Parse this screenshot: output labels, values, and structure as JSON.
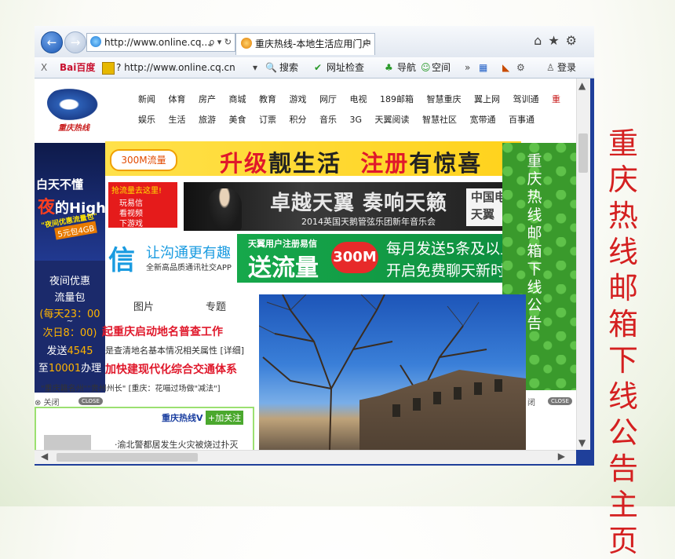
{
  "slide_title": "重庆热线邮箱下线公告主页",
  "browser": {
    "address": "http://www.online.cq...",
    "address_tools": "ϼ ▾ ↻",
    "tab_title": "重庆热线-本地生活应用门户",
    "toolbar": {
      "close_label": "X",
      "baidu": "Bai百度",
      "addr2": "? http://www.online.cq.cn",
      "search": "搜索",
      "site_check": "网址检查",
      "nav": "导航",
      "space": "空间",
      "login": "登录"
    }
  },
  "site": {
    "logo_text": "重庆热线",
    "nav_row1": [
      "新闻",
      "体育",
      "房产",
      "商城",
      "教育",
      "游戏",
      "网厅",
      "电视",
      "189邮箱",
      "智慧重庆",
      "翼上网",
      "驾训通",
      "重"
    ],
    "nav_row2": [
      "娱乐",
      "生活",
      "旅游",
      "美食",
      "订票",
      "积分",
      "音乐",
      "3G",
      "天翼阅读",
      "智慧社区",
      "宽带通",
      "百事通"
    ],
    "banner1_pill": "300M流量",
    "banner1_red1": "升级",
    "banner1_mid": "靓生活",
    "banner1_red2": "注册",
    "banner1_end": "有惊喜",
    "red_box": [
      "抢流量去这里!",
      "玩易信",
      "看视频",
      "下游戏"
    ],
    "concert_title": "卓越天翼 奏响天籁",
    "concert_sub": "2014英国天鹅管弦乐团新年音乐会",
    "concert_side": "中国电信 天翼",
    "yixin_big": "信",
    "yixin_title": "让沟通更有趣",
    "yixin_sub": "全新高品质通讯社交APP",
    "green_small": "天翼用户注册易信",
    "green_big": "送流量",
    "green_badge": "300M",
    "green_line1": "每月发送5条及以上",
    "green_line2": "开启免费聊天新时代",
    "left_ad": {
      "l1": "白天不懂",
      "l2a": "夜",
      "l2b": "的High",
      "l3": "\"夜间优惠流量包\"",
      "l4": "5元包4GB",
      "l5": "夜间优惠",
      "l6": "流量包",
      "l7": "(每天23：00",
      "l8": "~",
      "l9": "次日8：00)",
      "l10a": "发送",
      "l10b": "4545",
      "l11a": "至",
      "l11b": "10001",
      "l11c": "办理"
    },
    "right_ad": "重庆热线邮箱下线公告",
    "tabs": [
      "图片",
      "专题"
    ],
    "news_red1": "起重庆启动地名普查工作",
    "news_blk1": "是查清地名基本情况相关属性 [详细]",
    "news_red2": "加快建现代化综合交通体系",
    "news_blk2": "\"重庆籍名州\"\"贵州州长\" [重庆：花喵过场做\"减法\"]",
    "close_left": "⊗ 关闭",
    "close_btn": "CLOSE",
    "close_right": "闭",
    "weibo_title": "重庆热线V",
    "weibo_follow": "+加关注",
    "weibo_snip": "·渝北警都居发生火灾被烧过扑灭"
  }
}
